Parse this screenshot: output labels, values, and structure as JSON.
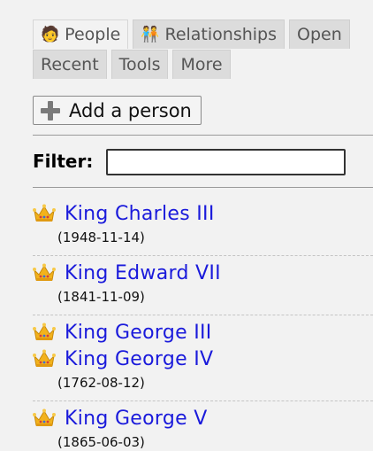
{
  "tabs": {
    "people": {
      "label": "People",
      "icon": "person-icon"
    },
    "relationships": {
      "label": "Relationships",
      "icon": "couple-icon"
    },
    "open": {
      "label": "Open"
    },
    "recent": {
      "label": "Recent"
    },
    "tools": {
      "label": "Tools"
    },
    "more": {
      "label": "More"
    }
  },
  "add_button": {
    "label": "Add a person",
    "icon": "plus-icon"
  },
  "filter": {
    "label": "Filter:",
    "value": ""
  },
  "people": [
    {
      "name": "King Charles III",
      "date": "(1948-11-14)",
      "icon": "crown-icon"
    },
    {
      "name": "King Edward VII",
      "date": "(1841-11-09)",
      "icon": "crown-icon"
    },
    {
      "name": "King George III",
      "date": "",
      "icon": "crown-icon"
    },
    {
      "name": "King George IV",
      "date": "(1762-08-12)",
      "icon": "crown-icon"
    },
    {
      "name": "King George V",
      "date": "(1865-06-03)",
      "icon": "crown-icon"
    }
  ],
  "colors": {
    "link": "#1a1adb",
    "background": "#f2f2f2",
    "tab": "#dcdcdc"
  }
}
